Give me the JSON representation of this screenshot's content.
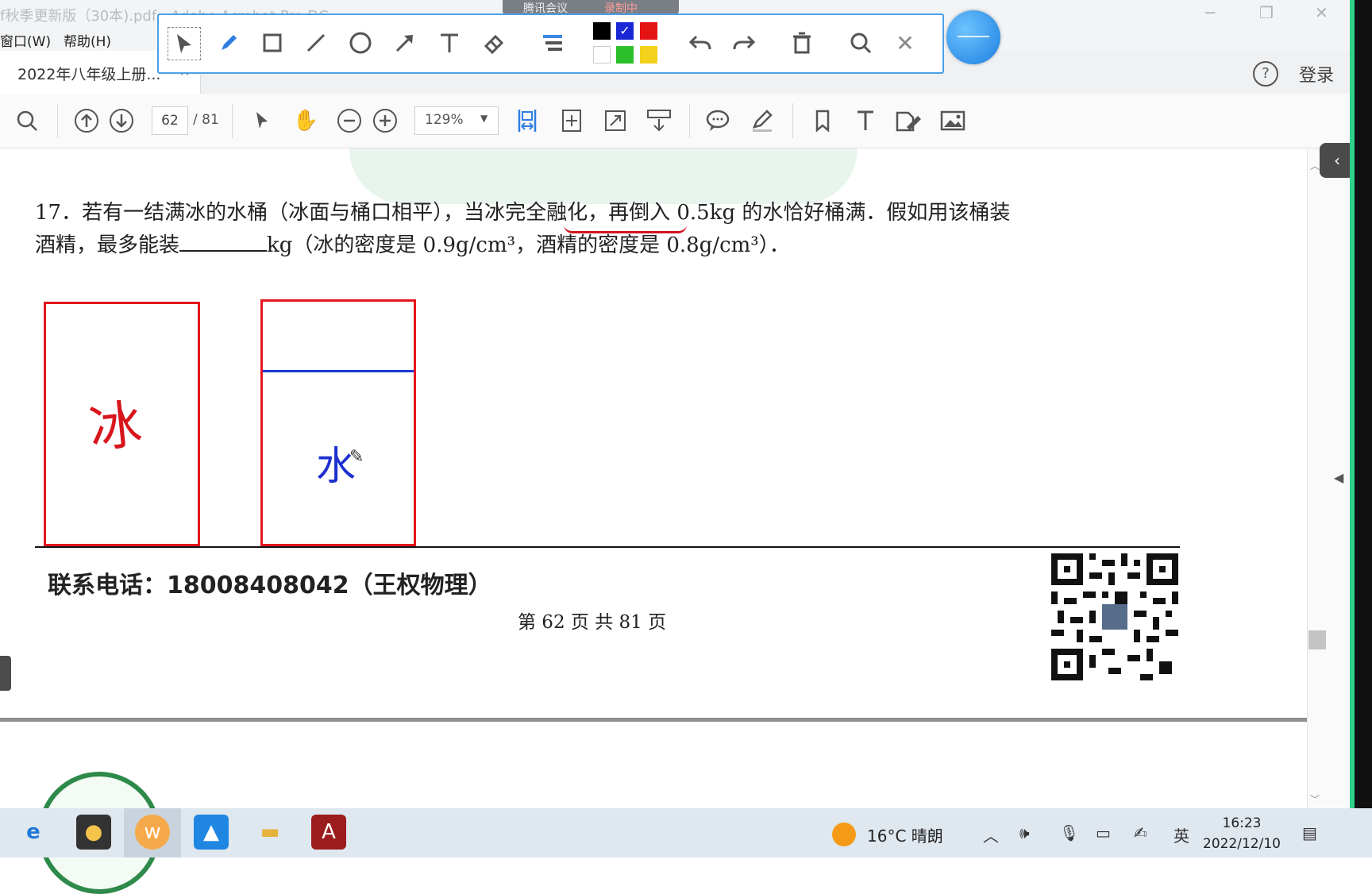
{
  "window": {
    "title": "f秋季更新版（30本).pdf - Adobe Acrobat Pro DC",
    "meeting_pill": {
      "left": "腾讯会议",
      "right": "录制中"
    }
  },
  "menu": {
    "window": "窗口(W)",
    "help": "帮助(H)"
  },
  "tab": {
    "title": "2022年八年级上册...",
    "close": "×"
  },
  "header_right": {
    "help": "?",
    "login": "登录"
  },
  "annotation_toolbar": {
    "tools": [
      "select-arrow-icon",
      "pen-icon",
      "rectangle-icon",
      "line-icon",
      "circle-icon",
      "arrow-icon",
      "text-icon",
      "eraser-icon",
      "line-width-icon",
      "undo-icon",
      "redo-icon",
      "trash-icon",
      "search-icon",
      "close-icon"
    ],
    "colors": [
      "#000000",
      "#1a27d4",
      "#e51414",
      "#ffffff",
      "#2bc02b",
      "#f2d21c"
    ],
    "selected_color": "#1a27d4"
  },
  "acrobat_toolbar": {
    "page_current": "62",
    "page_total": "/ 81",
    "zoom": "129%"
  },
  "document": {
    "question_line1": "17．若有一结满冰的水桶（冰面与桶口相平），当冰完全融化，再倒入 0.5kg 的水恰好桶满．假如用该桶装",
    "question_line2_a": "酒精，最多能装",
    "question_line2_b": "kg（冰的密度是 0.9g/cm³，酒精的密度是 0.8g/cm³）．",
    "ice_label": "冰",
    "water_label": "水",
    "contact": "联系电话：18008408042（王权物理）",
    "page_footer": "第 62 页 共 81 页"
  },
  "taskbar": {
    "apps": [
      "ie-icon",
      "bulb-app-icon",
      "w-app-icon",
      "photos-icon",
      "file-explorer-icon",
      "acrobat-icon"
    ],
    "weather": "16°C  晴朗",
    "ime": "英",
    "time": "16:23",
    "date": "2022/12/10"
  }
}
